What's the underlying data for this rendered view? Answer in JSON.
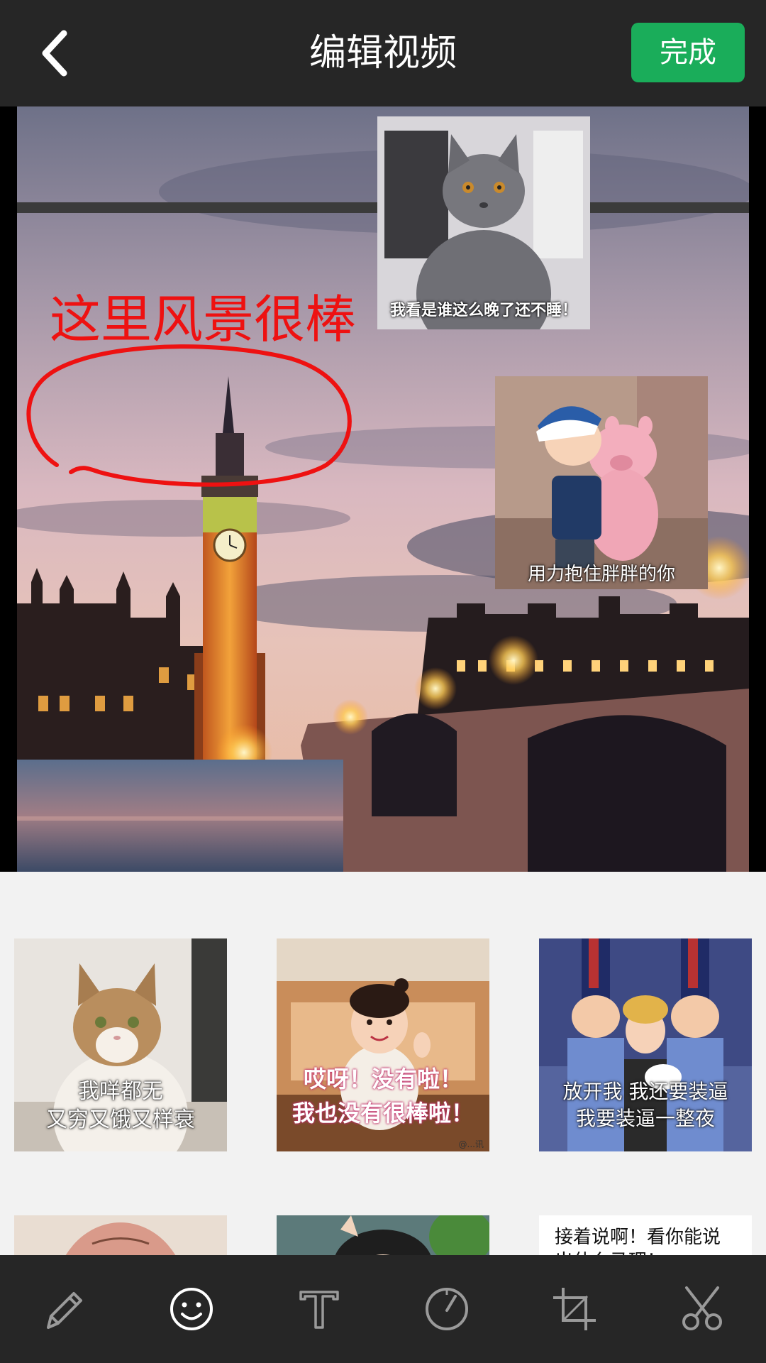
{
  "header": {
    "title": "编辑视频",
    "done_label": "完成"
  },
  "preview": {
    "annotation_text": "这里风景很棒",
    "stickers": [
      {
        "caption": "我看是谁这么晚了还不睡！"
      },
      {
        "caption": "用力抱住胖胖的你"
      }
    ]
  },
  "sticker_panel": {
    "items": [
      {
        "line1": "我咩都无",
        "line2": "又穷又饿又样衰"
      },
      {
        "line1": "哎呀！没有啦！",
        "line2": "我也没有很棒啦！",
        "watermark": "@...讯"
      },
      {
        "line1": "放开我 我还要装逼",
        "line2": "我要装逼一整夜"
      },
      {
        "line1": "",
        "line2": ""
      },
      {
        "line1": "",
        "line2": ""
      },
      {
        "line1": "接着说啊！看你能说",
        "line2": "出什么马理！"
      }
    ]
  },
  "toolbar": {
    "tools": [
      {
        "icon": "pencil-icon"
      },
      {
        "icon": "emoji-icon",
        "active": true
      },
      {
        "icon": "text-icon"
      },
      {
        "icon": "speed-icon"
      },
      {
        "icon": "crop-icon"
      },
      {
        "icon": "scissors-icon"
      }
    ]
  },
  "colors": {
    "accent": "#1aad5a",
    "annotation": "#ee1111",
    "bar": "#262626"
  }
}
